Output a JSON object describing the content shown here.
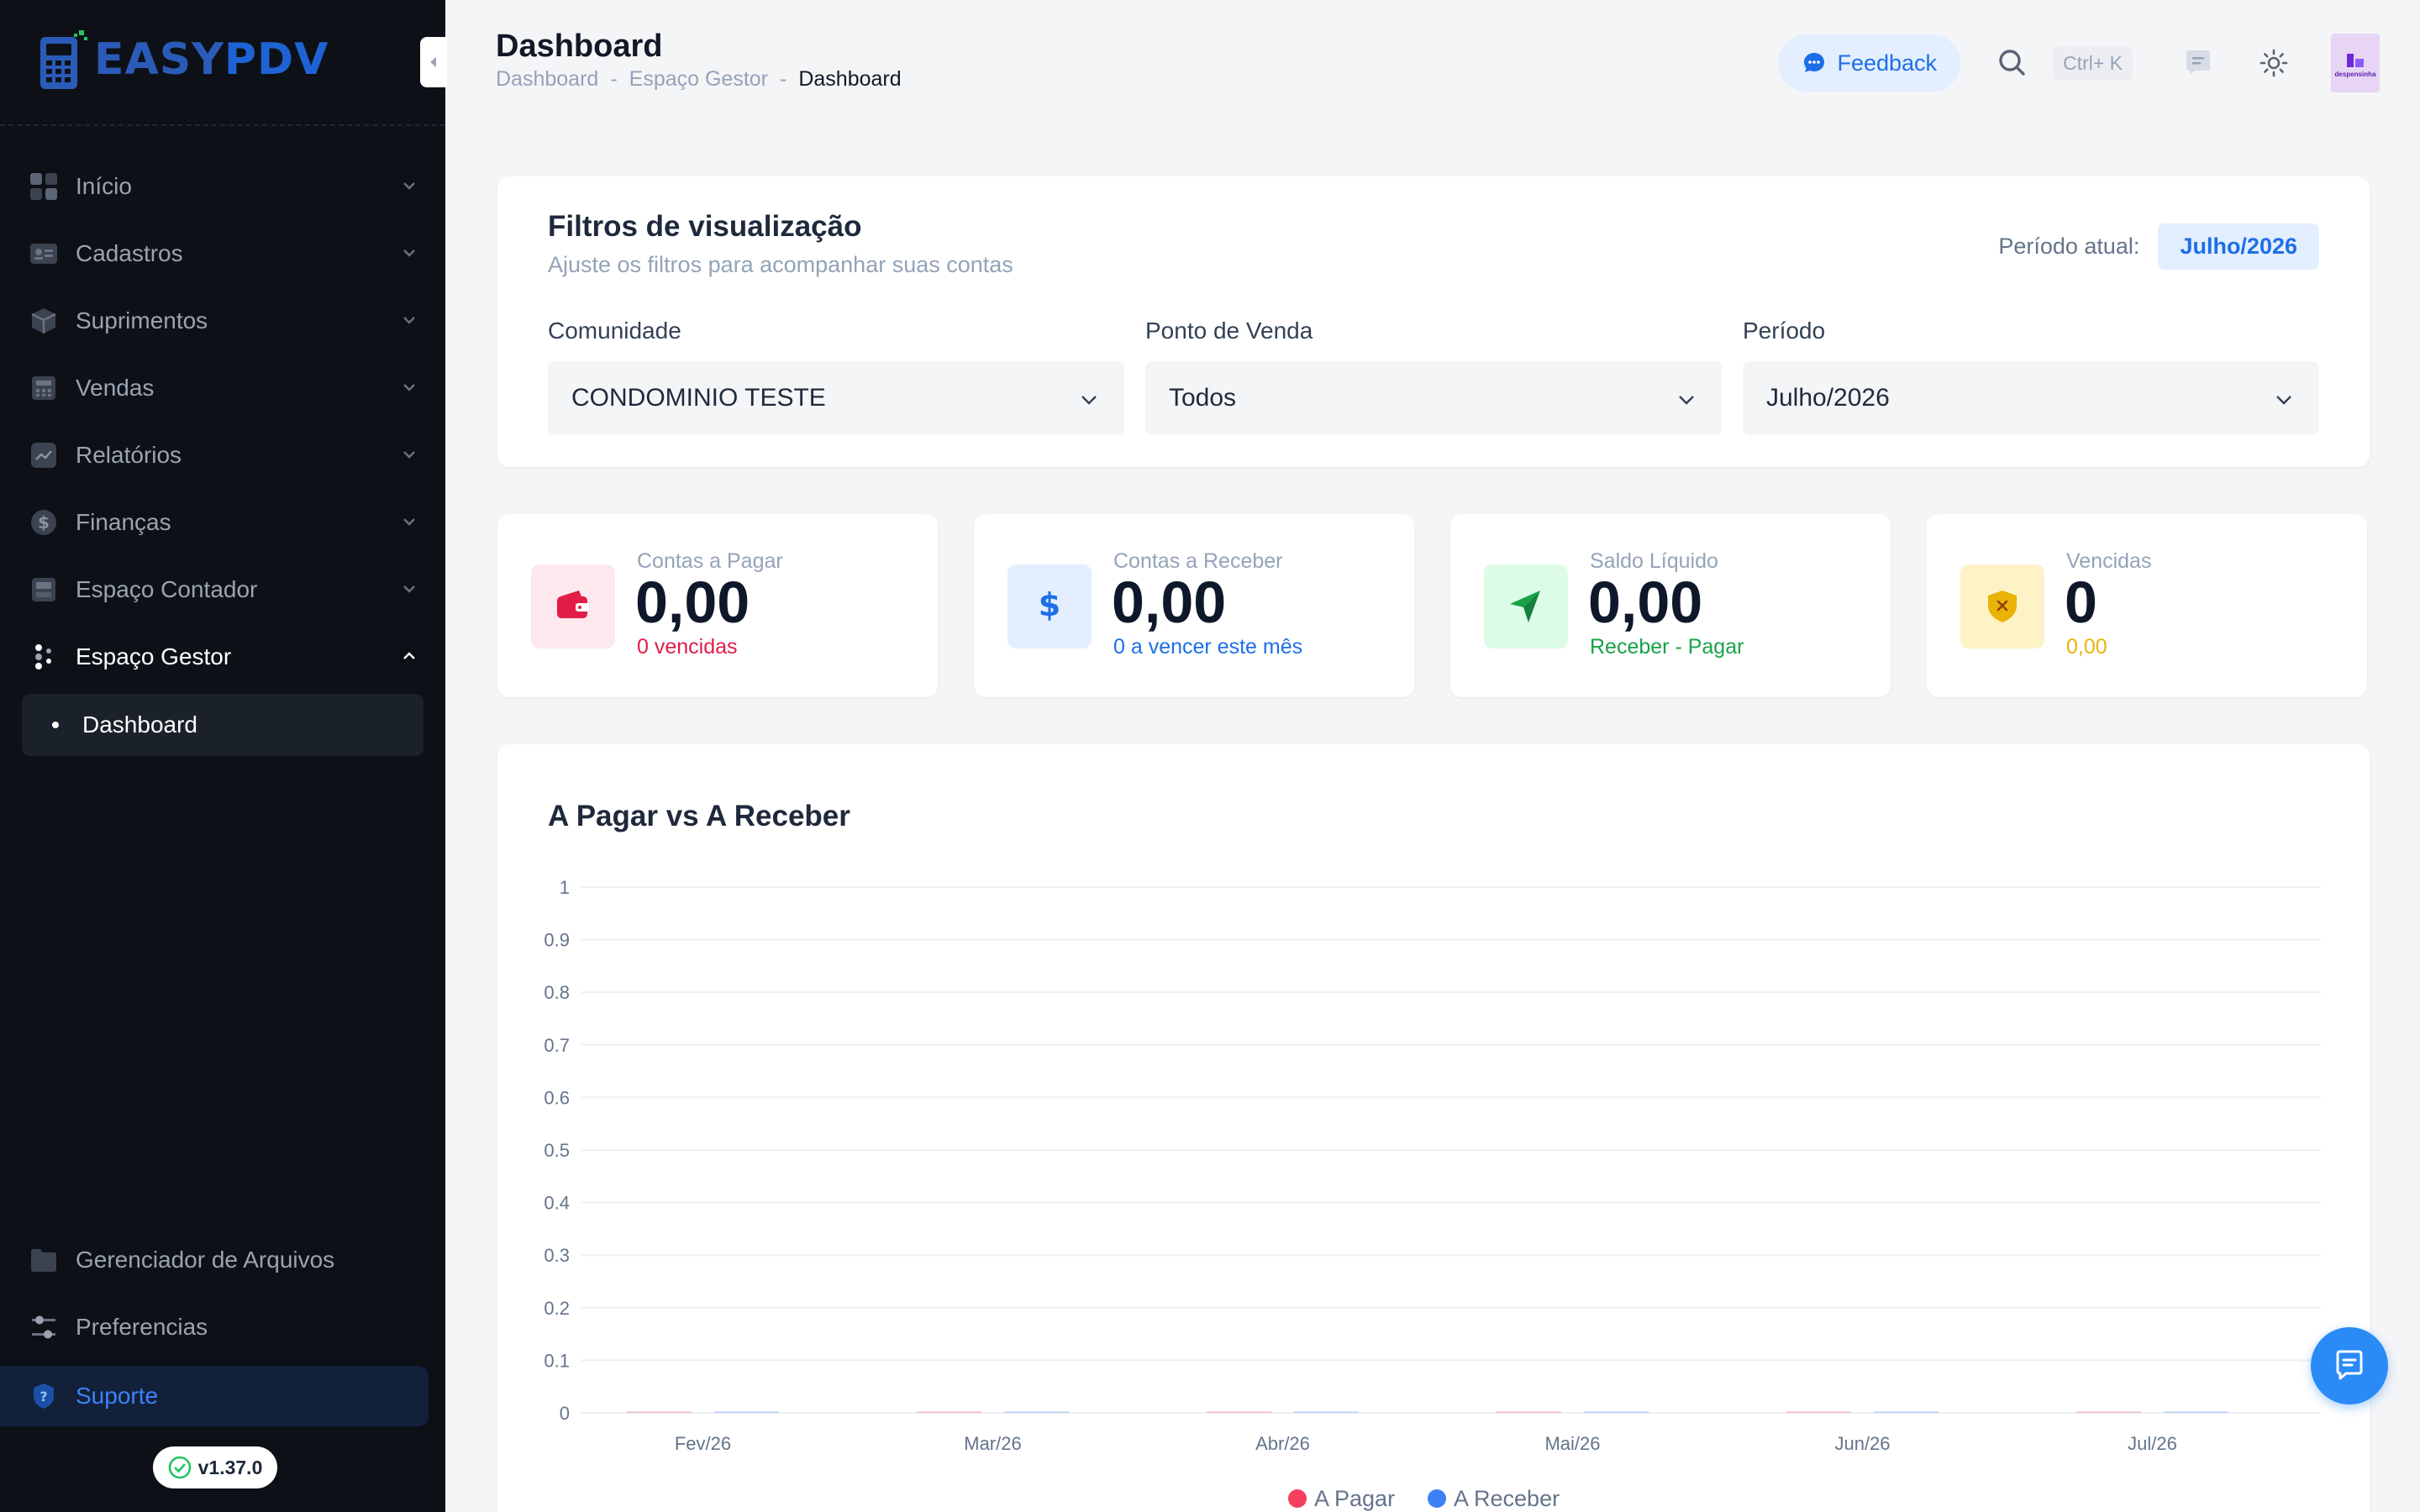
{
  "app": {
    "logo_prefix": "EASY",
    "logo_suffix": "PDV",
    "version": "v1.37.0"
  },
  "sidebar": {
    "items": [
      {
        "label": "Início",
        "icon": "grid-icon"
      },
      {
        "label": "Cadastros",
        "icon": "id-card-icon"
      },
      {
        "label": "Suprimentos",
        "icon": "box-icon"
      },
      {
        "label": "Vendas",
        "icon": "register-icon"
      },
      {
        "label": "Relatórios",
        "icon": "trend-icon"
      },
      {
        "label": "Finanças",
        "icon": "dollar-icon"
      },
      {
        "label": "Espaço Contador",
        "icon": "calculator-icon"
      },
      {
        "label": "Espaço Gestor",
        "icon": "people-icon"
      }
    ],
    "submenu": {
      "label": "Dashboard"
    },
    "bottom": [
      {
        "label": "Gerenciador de Arquivos",
        "icon": "folder-icon"
      },
      {
        "label": "Preferencias",
        "icon": "sliders-icon"
      }
    ],
    "support": {
      "label": "Suporte"
    }
  },
  "header": {
    "title": "Dashboard",
    "breadcrumb": [
      "Dashboard",
      "-",
      "Espaço Gestor",
      "-",
      "Dashboard"
    ],
    "feedback_label": "Feedback",
    "shortcut": "Ctrl+ K",
    "avatar_text": "despensinha"
  },
  "filters": {
    "title": "Filtros de visualização",
    "subtitle": "Ajuste os filtros para acompanhar suas contas",
    "periodo_label": "Período atual:",
    "periodo_value": "Julho/2026",
    "fields": [
      {
        "label": "Comunidade",
        "value": "CONDOMINIO TESTE"
      },
      {
        "label": "Ponto de Venda",
        "value": "Todos"
      },
      {
        "label": "Período",
        "value": "Julho/2026"
      }
    ]
  },
  "stats": [
    {
      "label": "Contas a Pagar",
      "value": "0,00",
      "sub": "0 vencidas",
      "color": "#e11d48",
      "bg": "#fde8ee",
      "icon": "wallet-icon"
    },
    {
      "label": "Contas a Receber",
      "value": "0,00",
      "sub": "0 a vencer este mês",
      "color": "#1d6fe8",
      "bg": "#e3eeff",
      "icon": "dollar-icon"
    },
    {
      "label": "Saldo Líquido",
      "value": "0,00",
      "sub": "Receber - Pagar",
      "color": "#16a34a",
      "bg": "#dcfce7",
      "icon": "send-icon"
    },
    {
      "label": "Vencidas",
      "value": "0",
      "sub": "0,00",
      "color": "#eab308",
      "bg": "#fef3c7",
      "icon": "shield-x-icon"
    }
  ],
  "chart_data": {
    "type": "bar",
    "title": "A Pagar vs A Receber",
    "categories": [
      "Fev/26",
      "Mar/26",
      "Abr/26",
      "Mai/26",
      "Jun/26",
      "Jul/26"
    ],
    "series": [
      {
        "name": "A Pagar",
        "values": [
          0,
          0,
          0,
          0,
          0,
          0
        ],
        "color": "#f43f5e"
      },
      {
        "name": "A Receber",
        "values": [
          0,
          0,
          0,
          0,
          0,
          0
        ],
        "color": "#3b82f6"
      }
    ],
    "ylim": [
      0,
      1
    ],
    "yticks": [
      "0",
      "0.1",
      "0.2",
      "0.3",
      "0.4",
      "0.5",
      "0.6",
      "0.7",
      "0.8",
      "0.9",
      "1"
    ],
    "legend": "bottom-center",
    "grid": true
  }
}
